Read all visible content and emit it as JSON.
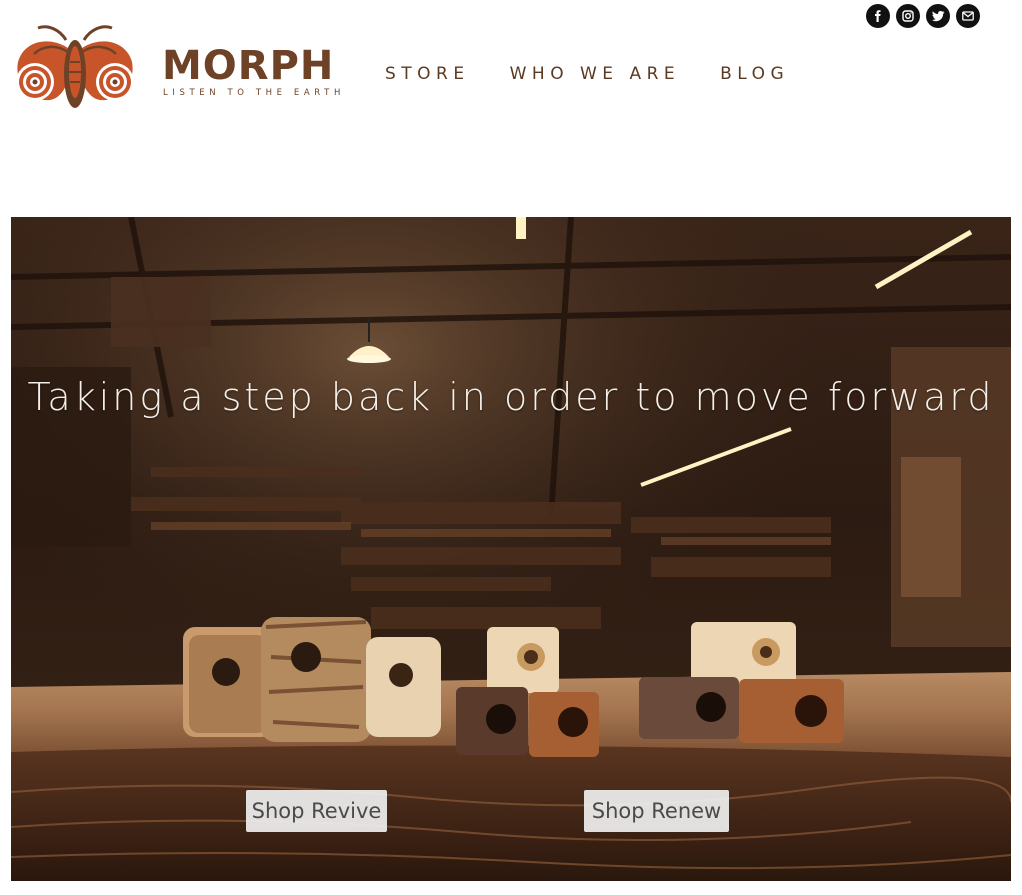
{
  "brand": {
    "name": "MORPH",
    "tagline": "LISTEN TO THE EARTH",
    "colors": {
      "primary": "#6e4226",
      "accent": "#c8542a"
    }
  },
  "nav": {
    "items": [
      {
        "label": "STORE"
      },
      {
        "label": "WHO WE ARE"
      },
      {
        "label": "BLOG"
      }
    ]
  },
  "social": {
    "icons": [
      "facebook-icon",
      "instagram-icon",
      "twitter-icon",
      "email-icon"
    ]
  },
  "hero": {
    "headline": "Taking a step back in order to move forward",
    "buttons": {
      "revive": "Shop Revive",
      "renew": "Shop Renew"
    }
  }
}
